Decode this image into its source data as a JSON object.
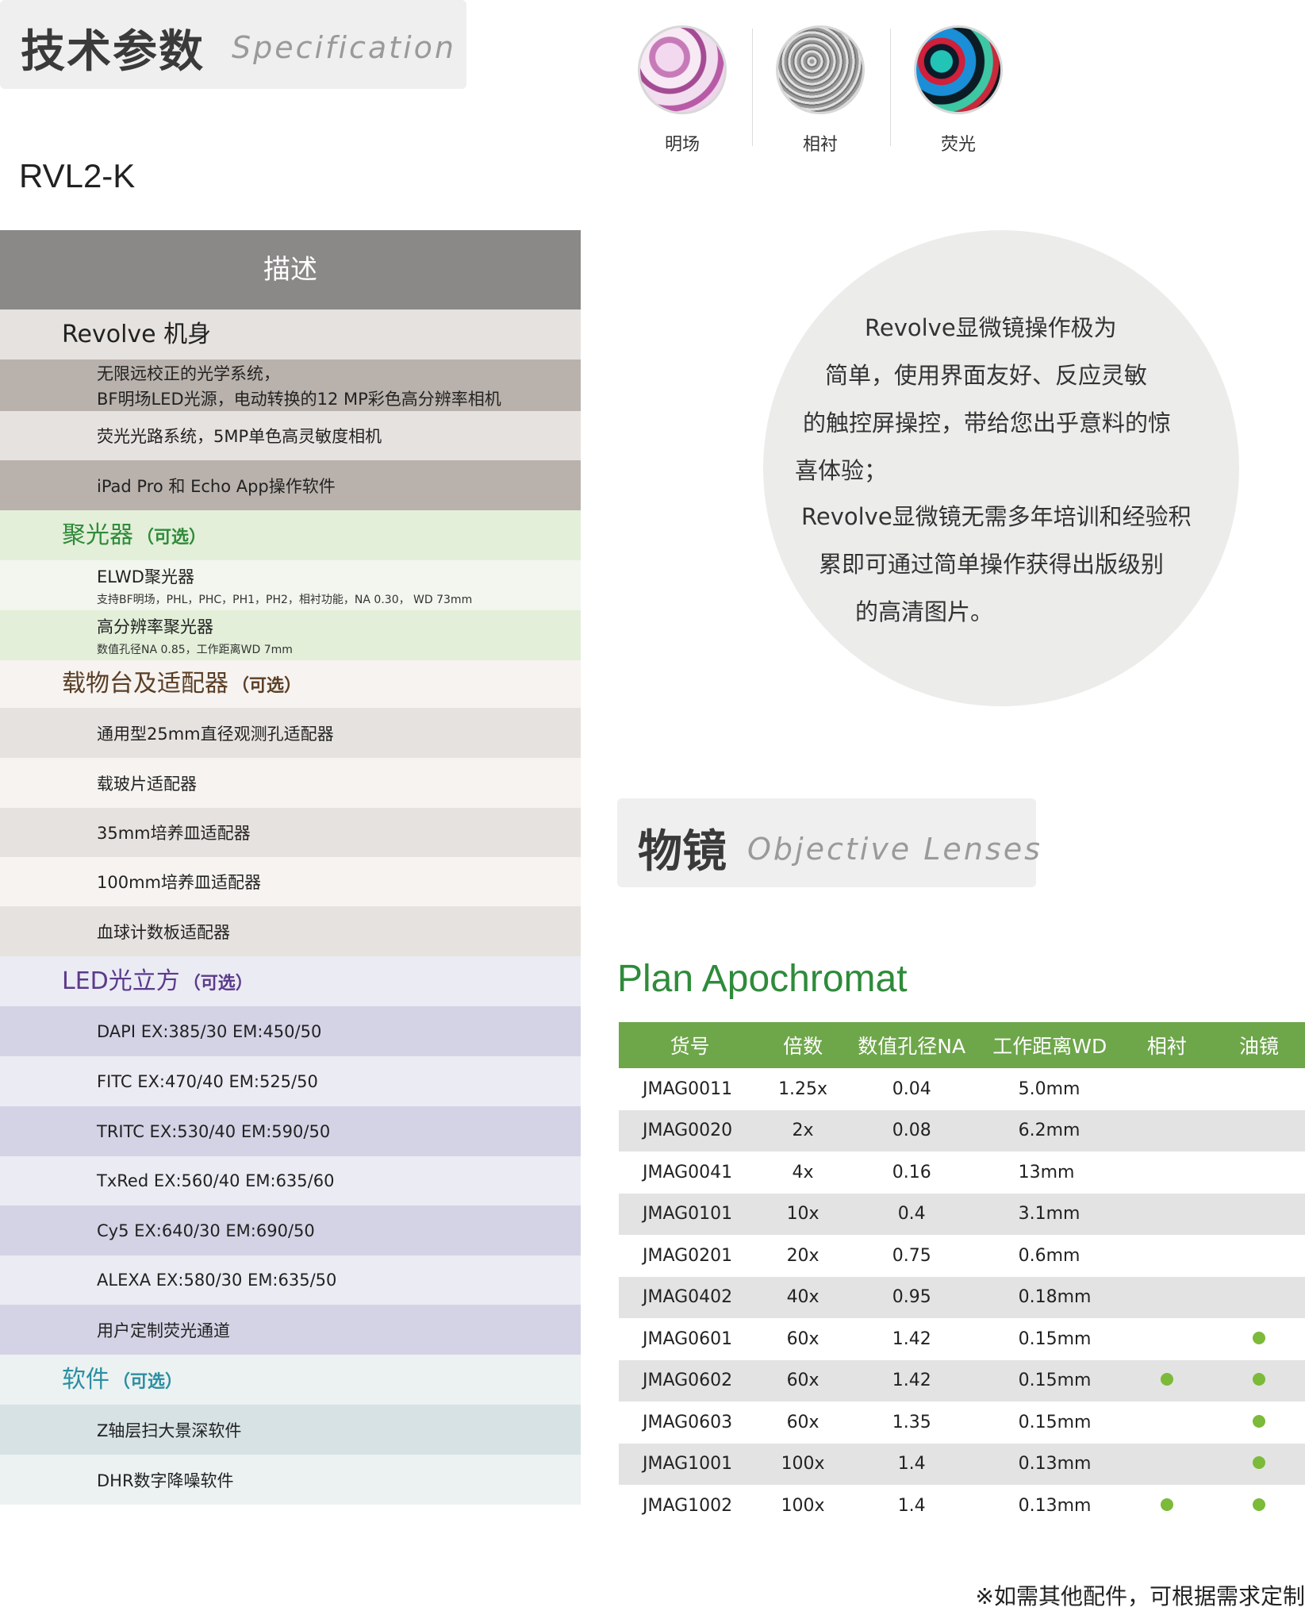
{
  "header": {
    "title_cn": "技术参数",
    "title_en": "Specification"
  },
  "model": "RVL2-K",
  "modes": [
    {
      "label": "明场",
      "icon": "brightfield-sample-icon"
    },
    {
      "label": "相衬",
      "icon": "phase-contrast-sample-icon"
    },
    {
      "label": "荧光",
      "icon": "fluorescence-sample-icon"
    }
  ],
  "table": {
    "header": "描述",
    "sections": [
      {
        "title": "Revolve 机身",
        "optional": "",
        "title_color": "#222222",
        "title_bg": "#e6e2df",
        "items": [
          {
            "text": "无限远校正的光学系统，",
            "text2": "BF明场LED光源，电动转换的12 MP彩色高分辨率相机",
            "bg": "#b9b2ac"
          },
          {
            "text": "荧光光路系统，5MP单色高灵敏度相机",
            "bg": "#e6e2df"
          },
          {
            "text": "iPad Pro 和 Echo App操作软件",
            "bg": "#b9b2ac"
          }
        ]
      },
      {
        "title": "聚光器",
        "optional": "（可选）",
        "title_color": "#2f8b3a",
        "title_bg": "#e3efd9",
        "items": [
          {
            "text": "ELWD聚光器",
            "sub": "支持BF明场，PHL，PHC，PH1，PH2，相衬功能，NA 0.30， WD 73mm",
            "bg": "#f2f6ee"
          },
          {
            "text": "高分辨率聚光器",
            "sub": "数值孔径NA 0.85，工作距离WD 7mm",
            "bg": "#e3efd9"
          }
        ]
      },
      {
        "title": "载物台及适配器",
        "optional": "（可选）",
        "title_color": "#5a3e25",
        "title_bg": "#f6f3f0",
        "items": [
          {
            "text": "通用型25mm直径观测孔适配器",
            "bg": "#e6e2df"
          },
          {
            "text": "载玻片适配器",
            "bg": "#f6f3f0"
          },
          {
            "text": "35mm培养皿适配器",
            "bg": "#e6e2df"
          },
          {
            "text": "100mm培养皿适配器",
            "bg": "#f6f3f0"
          },
          {
            "text": "血球计数板适配器",
            "bg": "#e6e2df"
          }
        ]
      },
      {
        "title": "LED光立方",
        "optional": "（可选）",
        "title_color": "#5b3a8a",
        "title_bg": "#ebebf4",
        "items": [
          {
            "text": "DAPI EX:385/30 EM:450/50",
            "bg": "#d4d3e6"
          },
          {
            "text": "FITC EX:470/40 EM:525/50",
            "bg": "#ebebf4"
          },
          {
            "text": "TRITC EX:530/40 EM:590/50",
            "bg": "#d4d3e6"
          },
          {
            "text": "TxRed EX:560/40 EM:635/60",
            "bg": "#ebebf4"
          },
          {
            "text": "Cy5 EX:640/30 EM:690/50",
            "bg": "#d4d3e6"
          },
          {
            "text": "ALEXA EX:580/30 EM:635/50",
            "bg": "#ebebf4"
          },
          {
            "text": "用户定制荧光通道",
            "bg": "#d4d3e6"
          }
        ]
      },
      {
        "title": "软件",
        "optional": "（可选）",
        "title_color": "#2a8fa0",
        "title_bg": "#ecf1f2",
        "items": [
          {
            "text": "Z轴层扫大景深软件",
            "bg": "#d7e2e4"
          },
          {
            "text": "DHR数字降噪软件",
            "bg": "#ecf1f2"
          }
        ]
      }
    ]
  },
  "circle_text": [
    "Revolve显微镜操作极为",
    "简单，使用界面友好、反应灵敏",
    "的触控屏操控，带给您出乎意料的惊",
    "喜体验；",
    "Revolve显微镜无需多年培训和经验积",
    "累即可通过简单操作获得出版级别",
    "的高清图片。"
  ],
  "objectives": {
    "title_cn": "物镜",
    "title_en": "Objective Lenses",
    "series": "Plan Apochromat",
    "columns": [
      "货号",
      "倍数",
      "数值孔径NA",
      "工作距离WD",
      "相衬",
      "油镜"
    ],
    "rows": [
      {
        "id": "JMAG0011",
        "mag": "1.25x",
        "na": "0.04",
        "wd": "5.0mm",
        "phase": false,
        "oil": false
      },
      {
        "id": "JMAG0020",
        "mag": "2x",
        "na": "0.08",
        "wd": "6.2mm",
        "phase": false,
        "oil": false
      },
      {
        "id": "JMAG0041",
        "mag": "4x",
        "na": "0.16",
        "wd": "13mm",
        "phase": false,
        "oil": false
      },
      {
        "id": "JMAG0101",
        "mag": "10x",
        "na": "0.4",
        "wd": "3.1mm",
        "phase": false,
        "oil": false
      },
      {
        "id": "JMAG0201",
        "mag": "20x",
        "na": "0.75",
        "wd": "0.6mm",
        "phase": false,
        "oil": false
      },
      {
        "id": "JMAG0402",
        "mag": "40x",
        "na": "0.95",
        "wd": "0.18mm",
        "phase": false,
        "oil": false
      },
      {
        "id": "JMAG0601",
        "mag": "60x",
        "na": "1.42",
        "wd": "0.15mm",
        "phase": false,
        "oil": true
      },
      {
        "id": "JMAG0602",
        "mag": "60x",
        "na": "1.42",
        "wd": "0.15mm",
        "phase": true,
        "oil": true
      },
      {
        "id": "JMAG0603",
        "mag": "60x",
        "na": "1.35",
        "wd": "0.15mm",
        "phase": false,
        "oil": true
      },
      {
        "id": "JMAG1001",
        "mag": "100x",
        "na": "1.4",
        "wd": "0.13mm",
        "phase": false,
        "oil": true
      },
      {
        "id": "JMAG1002",
        "mag": "100x",
        "na": "1.4",
        "wd": "0.13mm",
        "phase": true,
        "oil": true
      }
    ]
  },
  "footnote": "※如需其他配件，可根据需求定制",
  "colors": {
    "accent_green": "#6ea64a",
    "dot_green": "#7cba3a",
    "header_gray": "#8a8987"
  }
}
